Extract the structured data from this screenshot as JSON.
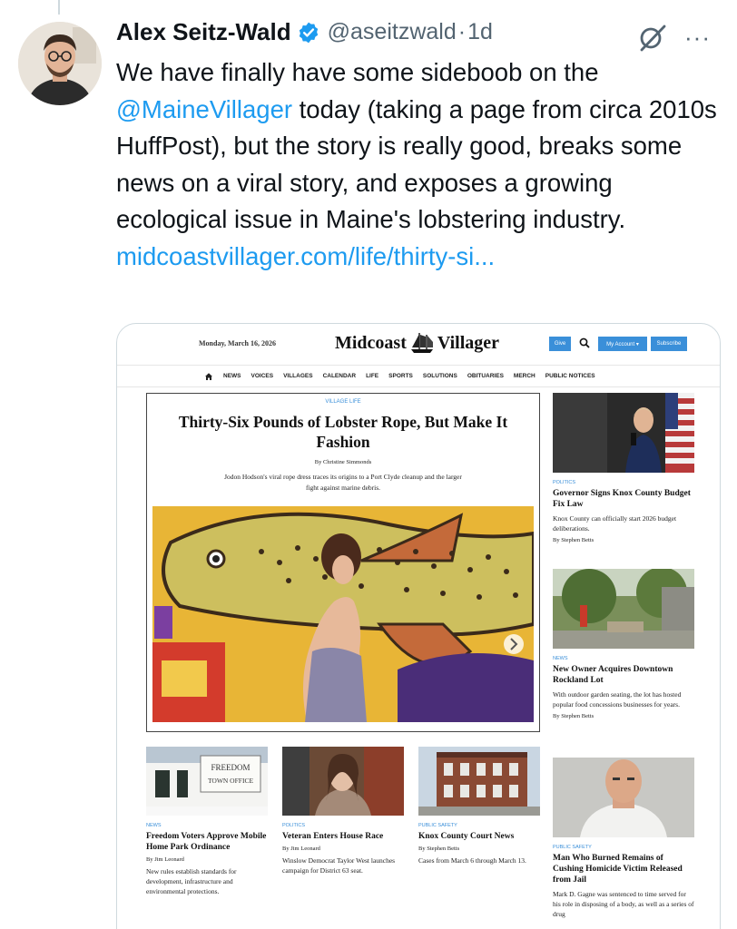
{
  "tweet": {
    "author_name": "Alex Seitz-Wald",
    "handle": "@aseitzwald",
    "separator": "·",
    "time": "1d",
    "more_label": "···",
    "text_part1": "We have finally have some sideboob on the ",
    "mention": "@MaineVillager",
    "text_part2": " today (taking a page from circa 2010s HuffPost), but the story is really good, breaks some news on a viral story, and exposes a growing ecological issue in Maine's lobstering industry. ",
    "link": "midcoastvillager.com/life/thirty-si..."
  },
  "site": {
    "date": "Monday, March 16, 2026",
    "logo_left": "Midcoast",
    "logo_right": "Villager",
    "give_label": "Give",
    "account_label": "My Account ▾",
    "subscribe_label": "Subscribe",
    "nav": [
      "NEWS",
      "VOICES",
      "VILLAGES",
      "CALENDAR",
      "LIFE",
      "SPORTS",
      "SOLUTIONS",
      "OBITUARIES",
      "MERCH",
      "PUBLIC NOTICES"
    ]
  },
  "hero": {
    "category": "VILLAGE LIFE",
    "title": "Thirty-Six Pounds of Lobster Rope, But Make It Fashion",
    "byline": "By Christine Simmonds",
    "dek": "Jodon Hodson's viral rope dress traces its origins to a Port Clyde cleanup and the larger fight against marine debris."
  },
  "side_stories": [
    {
      "category": "POLITICS",
      "title": "Governor Signs Knox County Budget Fix Law",
      "dek": "Knox County can officially start 2026 budget deliberations.",
      "byline": "By Stephen Betts"
    },
    {
      "category": "NEWS",
      "title": "New Owner Acquires Downtown Rockland Lot",
      "dek": "With outdoor garden seating, the lot has hosted popular food concessions businesses for years.",
      "byline": "By Stephen Betts"
    },
    {
      "category": "PUBLIC SAFETY",
      "title": "Man Who Burned Remains of Cushing Homicide Victim Released from Jail",
      "dek": "Mark D. Gagne was sentenced to time served for his role in disposing of a body, as well as a series of drug",
      "byline": ""
    }
  ],
  "bottom_stories": [
    {
      "category": "NEWS",
      "title": "Freedom Voters Approve Mobile Home Park Ordinance",
      "byline": "By Jim Leonard",
      "dek": "New rules establish standards for development, infrastructure and environmental protections.",
      "sign_line1": "FREEDOM",
      "sign_line2": "TOWN OFFICE"
    },
    {
      "category": "POLITICS",
      "title": "Veteran Enters House Race",
      "byline": "By Jim Leonard",
      "dek": "Winslow Democrat Taylor West launches campaign for District 63 seat."
    },
    {
      "category": "PUBLIC SAFETY",
      "title": "Knox County Court News",
      "byline": "By Stephen Betts",
      "dek": "Cases from March 6 through March 13."
    }
  ],
  "colors": {
    "accent": "#1d9bf0",
    "site_blue": "#3a8fd9",
    "text": "#0f1419",
    "muted": "#536471"
  }
}
